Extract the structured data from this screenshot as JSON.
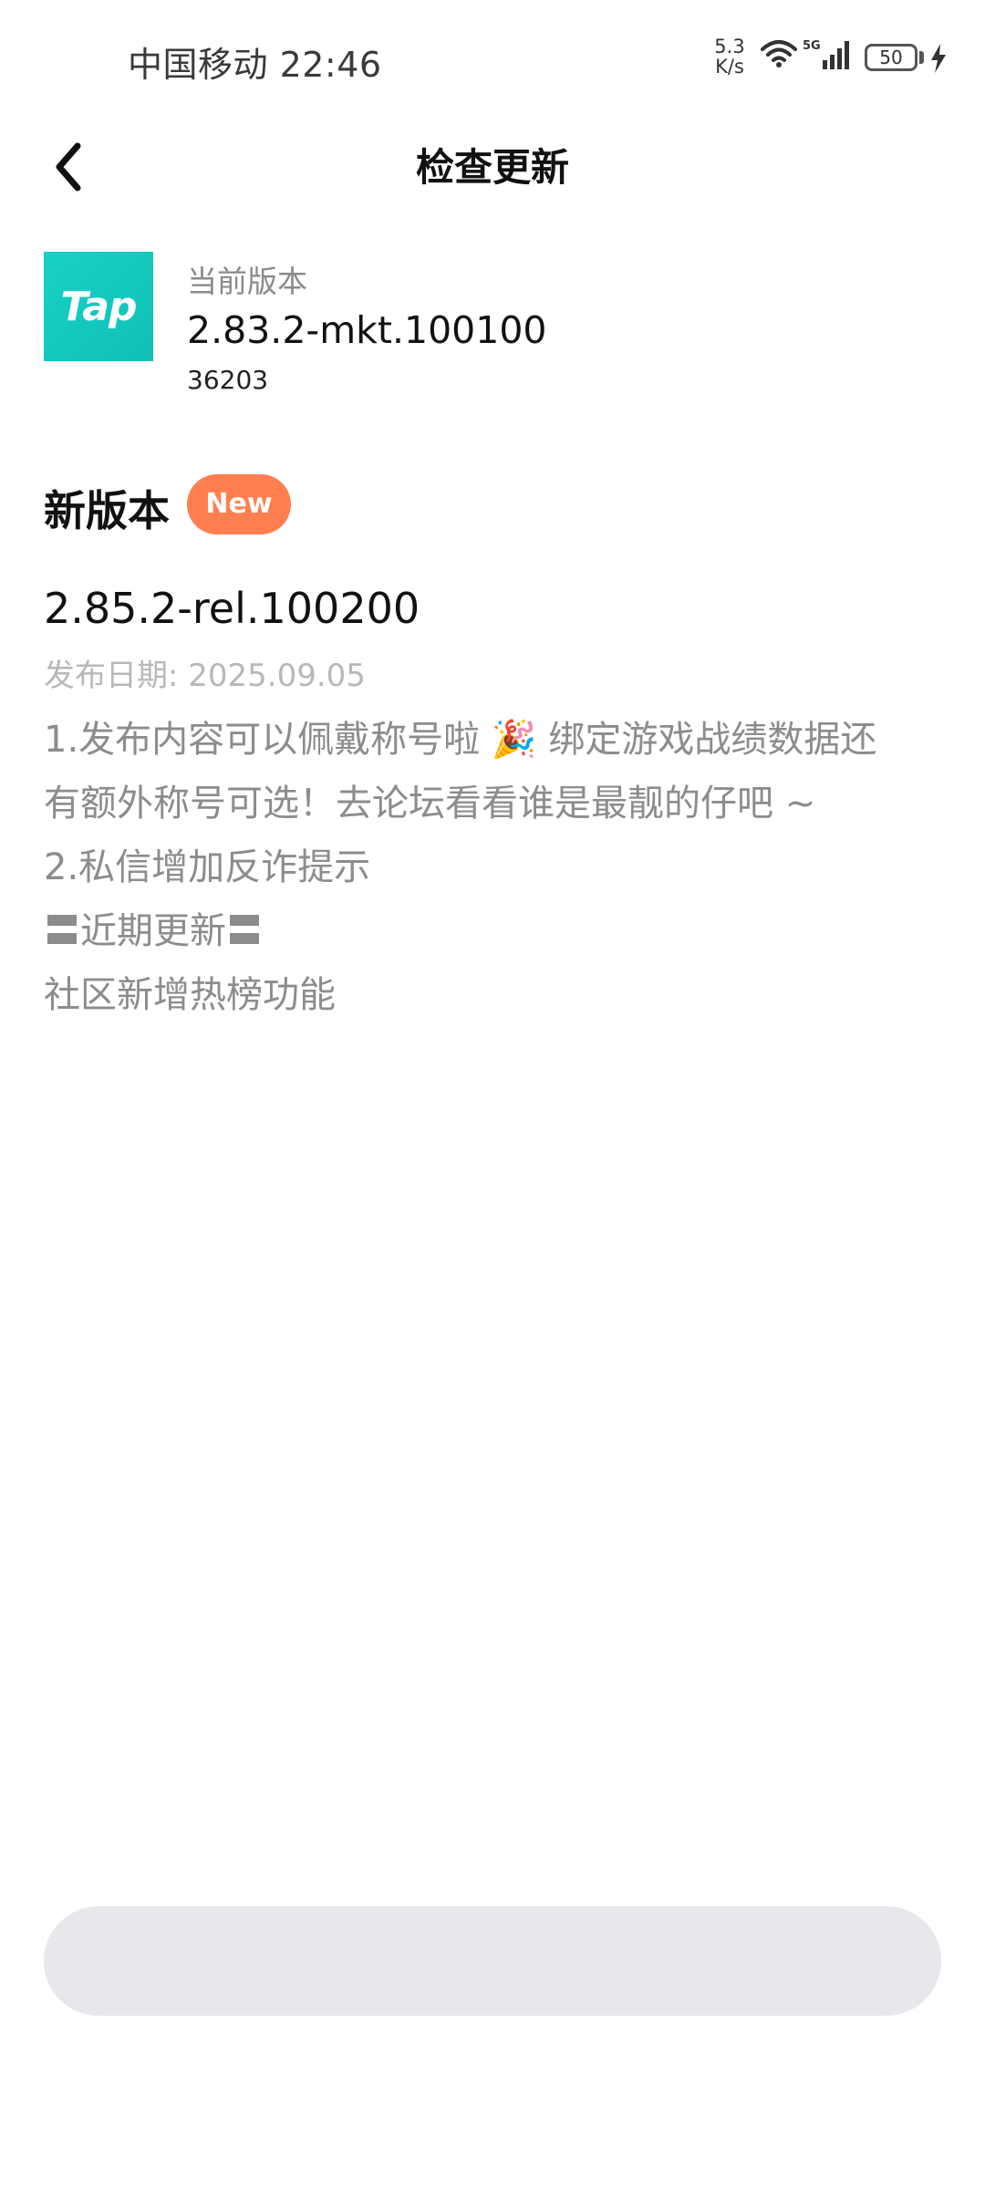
{
  "status_bar": {
    "carrier_time": "中国移动 22:46",
    "net_speed_value": "5.3",
    "net_speed_unit": "K/s",
    "network_type": "5G",
    "battery": "50"
  },
  "nav": {
    "title": "检查更新"
  },
  "current": {
    "app_icon_text": "Tap",
    "label": "当前版本",
    "version": "2.83.2-mkt.100100",
    "build": "36203"
  },
  "new_version": {
    "section_title": "新版本",
    "badge": "New",
    "version": "2.85.2-rel.100200",
    "release_date": "发布日期: 2025.09.05",
    "notes": [
      "1.发布内容可以佩戴称号啦 🎉 绑定游戏战绩数据还",
      "有额外称号可选！去论坛看看谁是最靓的仔吧 ~",
      "2.私信增加反诈提示",
      "〓近期更新〓",
      "社区新增热榜功能"
    ]
  },
  "bottom": {
    "button_label": ""
  },
  "colors": {
    "accent_badge": "#ff7f50",
    "app_icon": "#19d2c4",
    "button_bg": "#e6e8eb"
  }
}
